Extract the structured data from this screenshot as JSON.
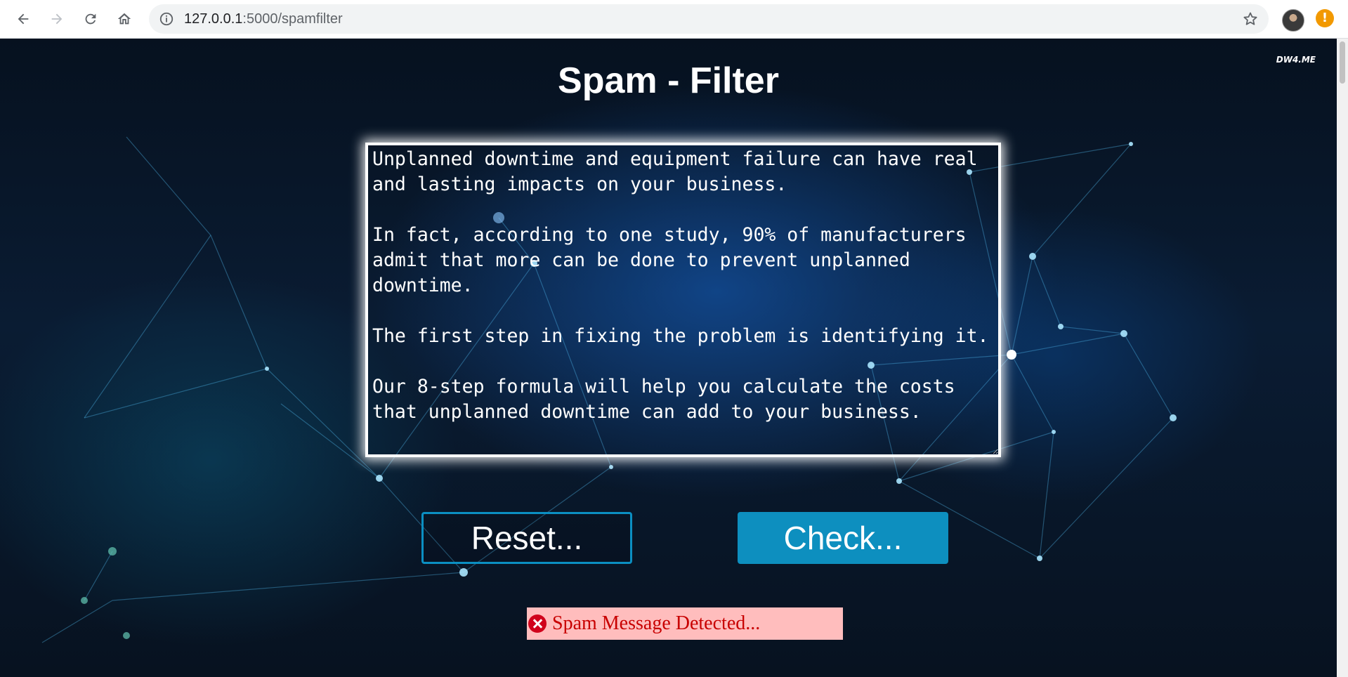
{
  "browser": {
    "url_host": "127.0.0.1",
    "url_path": ":5000/spamfilter"
  },
  "page": {
    "watermark": "DW4.ME",
    "title": "Spam - Filter",
    "message_text": "Unplanned downtime and equipment failure can have real and lasting impacts on your business.\n\nIn fact, according to one study, 90% of manufacturers admit that more can be done to prevent unplanned downtime.\n\nThe first step in fixing the problem is identifying it.\n\nOur 8-step formula will help you calculate the costs that unplanned downtime can add to your business.",
    "reset_label": "Reset...",
    "check_label": "Check...",
    "result_text": "Spam Message Detected..."
  },
  "colors": {
    "accent": "#0d8fbf",
    "result_bg": "#ffbdbd",
    "result_text": "#c80000"
  },
  "icons": {
    "back": "back-arrow-icon",
    "forward": "forward-arrow-icon",
    "reload": "reload-icon",
    "home": "home-icon",
    "info": "info-icon",
    "bookmark": "star-icon",
    "alert": "alert-icon",
    "result": "error-x-icon"
  }
}
